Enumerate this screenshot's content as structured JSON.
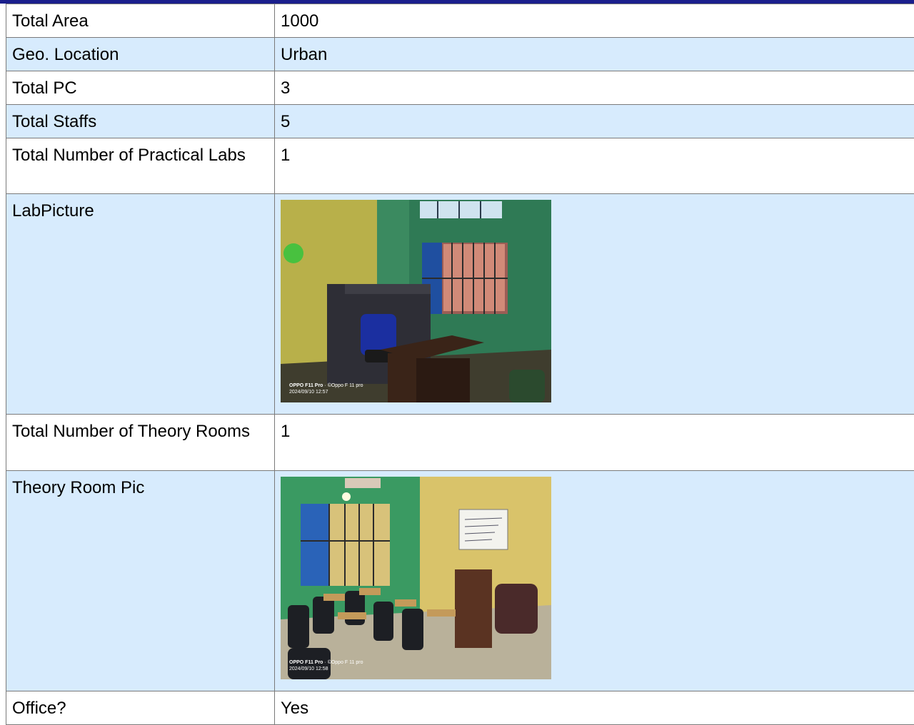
{
  "rows": [
    {
      "label": "Total Area",
      "value": "1000"
    },
    {
      "label": "Geo. Location",
      "value": "Urban"
    },
    {
      "label": "Total PC",
      "value": "3"
    },
    {
      "label": "Total Staffs",
      "value": "5"
    },
    {
      "label": "Total Number of Practical Labs",
      "value": "1"
    },
    {
      "label": "LabPicture",
      "photo": {
        "stamp_brand": "OPPO F11 Pro",
        "stamp_sub": " · ©Oppo F 11 pro",
        "stamp_time": "2024/09/10 12:57"
      }
    },
    {
      "label": "Total Number of Theory Rooms",
      "value": "1"
    },
    {
      "label": "Theory Room Pic",
      "photo": {
        "stamp_brand": "OPPO F11 Pro",
        "stamp_sub": " · ©Oppo F 11 pro",
        "stamp_time": "2024/09/10 12:58"
      }
    },
    {
      "label": "Office?",
      "value": "Yes"
    }
  ],
  "colors": {
    "header_bar": "#1a1f8c",
    "row_shade": "#d7ebfd",
    "border": "#7a7a7a"
  }
}
